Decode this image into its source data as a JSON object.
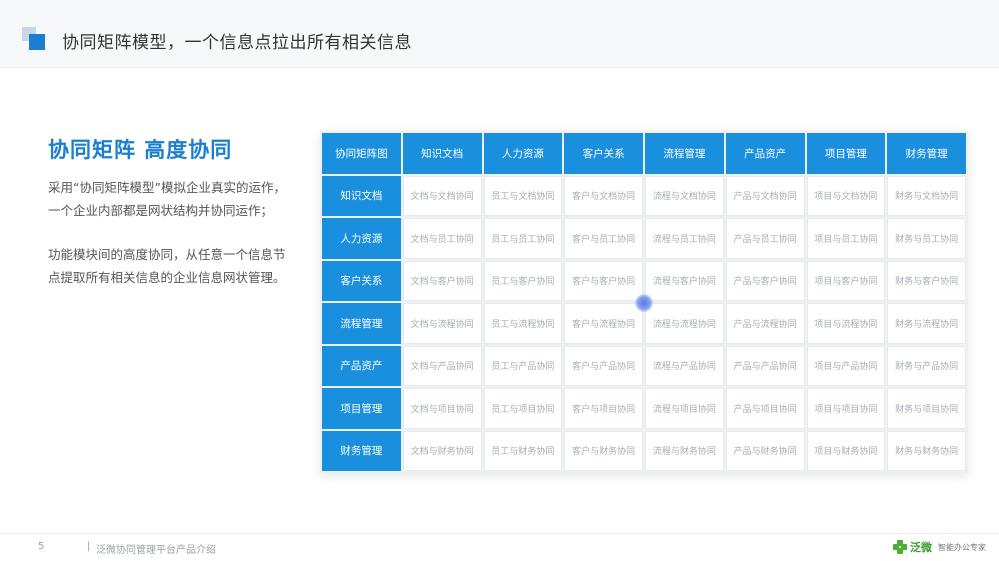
{
  "header": {
    "title": "协同矩阵模型，一个信息点拉出所有相关信息"
  },
  "left": {
    "heading": "协同矩阵  高度协同",
    "para1_line1": "采用“协同矩阵模型”模拟企业真实的运作，",
    "para1_line2": "一个企业内部都是网状结构并协同运作；",
    "para2_line1": "功能模块间的高度协同，从任意一个信息节",
    "para2_line2": "点提取所有相关信息的企业信息网状管理。"
  },
  "matrix": {
    "corner": "协同矩阵图",
    "columns": [
      "知识文档",
      "人力资源",
      "客户关系",
      "流程管理",
      "产品资产",
      "项目管理",
      "财务管理"
    ],
    "rows": [
      {
        "label": "知识文档",
        "cells": [
          "文档与文档协同",
          "员工与文档协同",
          "客户与文档协同",
          "流程与文档协同",
          "产品与文档协同",
          "项目与文档协同",
          "财务与文档协同"
        ]
      },
      {
        "label": "人力资源",
        "cells": [
          "文档与员工协同",
          "员工与员工协同",
          "客户与员工协同",
          "流程与员工协同",
          "产品与员工协同",
          "项目与员工协同",
          "财务与员工协同"
        ]
      },
      {
        "label": "客户关系",
        "cells": [
          "文档与客户协同",
          "员工与客户协同",
          "客户与客户协同",
          "流程与客户协同",
          "产品与客户协同",
          "项目与客户协同",
          "财务与客户协同"
        ]
      },
      {
        "label": "流程管理",
        "cells": [
          "文档与流程协同",
          "员工与流程协同",
          "客户与流程协同",
          "流程与流程协同",
          "产品与流程协同",
          "项目与流程协同",
          "财务与流程协同"
        ]
      },
      {
        "label": "产品资产",
        "cells": [
          "文档与产品协同",
          "员工与产品协同",
          "客户与产品协同",
          "流程与产品协同",
          "产品与产品协同",
          "项目与产品协同",
          "财务与产品协同"
        ]
      },
      {
        "label": "项目管理",
        "cells": [
          "文档与项目协同",
          "员工与项目协同",
          "客户与项目协同",
          "流程与项目协同",
          "产品与项目协同",
          "项目与项目协同",
          "财务与项目协同"
        ]
      },
      {
        "label": "财务管理",
        "cells": [
          "文档与财务协同",
          "员工与财务协同",
          "客户与财务协同",
          "流程与财务协同",
          "产品与财务协同",
          "项目与财务协同",
          "财务与财务协同"
        ]
      }
    ]
  },
  "footer": {
    "page_number": "5",
    "separator": "|",
    "text": "泛微协同管理平台产品介绍",
    "brand_name": "泛微",
    "brand_slogan": "智能办公专家"
  },
  "colors": {
    "accent": "#1a8fde",
    "title_blue": "#1a7fd1",
    "brand_green": "#4caf32"
  },
  "icons": {
    "header_logo": "square-logo-icon",
    "brand_logo": "weaver-leaf-icon"
  }
}
